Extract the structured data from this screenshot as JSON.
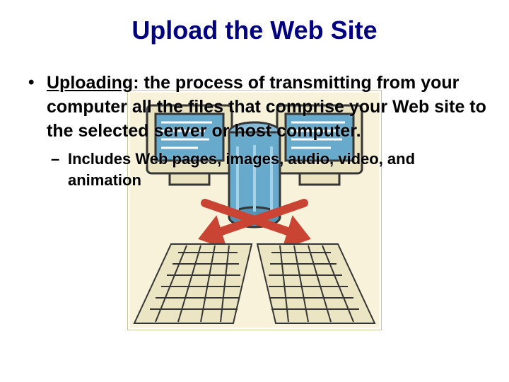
{
  "title": "Upload the Web Site",
  "bullet": {
    "term": "Uploading",
    "rest": ":  the process of transmitting from your computer all the files that comprise your Web site to the selected server or host computer."
  },
  "sub": "Includes Web pages, images, audio, video, and animation"
}
